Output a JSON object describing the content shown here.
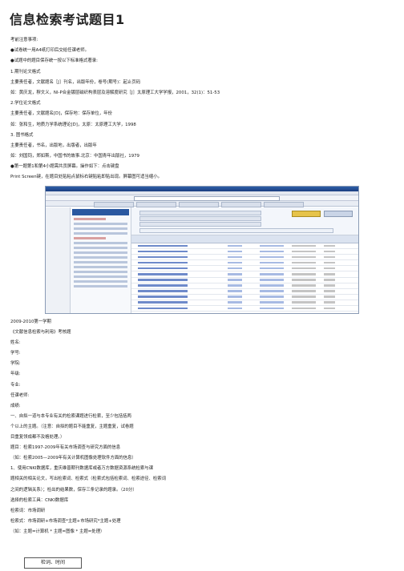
{
  "title": "信息检索考试题目1",
  "intro_lines": [
    "考前注意事项:",
    "●试卷统一用A4纸打印后交给任课老师。",
    "●试题中的题目保存统一按以下标准格式著录:",
    "1.期刊论文格式",
    "主要责任者，文献题名［J］刊名，出版年份，卷号(期号)：起止页码",
    "如：黄庆龙，穆文义，NI-P合金镀层磁织构表层及溶解度研究［J］太原理工大学学报，2001，32(1)：51-53",
    "2.学位论文格式",
    "主要责任者，文献题名[D]，保存地：保存单位，年份",
    "如：张和生，地质力学系统理论[D]，太原：太原理工大学，1998",
    "3. 图书格式",
    "主要责任者，书名，出版地，出版者，出版年",
    "如：刘国钧，郑如斯，中国书的故事.北京：中国青年出版社，1979",
    "●第一题第1和第4小题需共贡屏幕。操作如下：点击键盘",
    "Print Screen键，在题目处贴粘点鼠标右键贴粘即贴出现。屏幕图可适当缩小。"
  ],
  "screenshot": {
    "description_icon": "browser-search-screenshot"
  },
  "body_lines": [
    "2009-2010第一学期",
    "《文献信息检索与利用》考核题",
    "姓名:",
    "学号:",
    "学院:",
    "年级:",
    "专业:",
    "任课老师:",
    "成绩:",
    "一、自拟一道与本专业有关的检索课题进行检索，至少包括括两",
    "个以上的主题。（注意：自拟的题目不能重复，主题重复，试卷题",
    "目重复领成都不及格处理。）",
    "题目：检索1997-2009年有关市场调查与研究方面的信息",
    "（如：检索2005—2009年有关计算机图像处理软件方面的信息）",
    "1、使用CNKI数据库，重庆维普期刊数据库或者万方数据资源系统检索与课",
    "题相关的相关论文，写出检索词、检索式（检索式包括检索词、检索途径、检索词",
    "之间的逻辑关系）；检出的结果数，保存三条记录的题录。（20分）",
    "选择的检索工具：CNKI数据库",
    "检索词：市场调研",
    "检索式：市场调研+市场调查*主题+市场研究*主题+处理",
    "（如：主题=计算机 * 主题=图像 * 主题=处理）"
  ],
  "note_box": "检词、时间"
}
